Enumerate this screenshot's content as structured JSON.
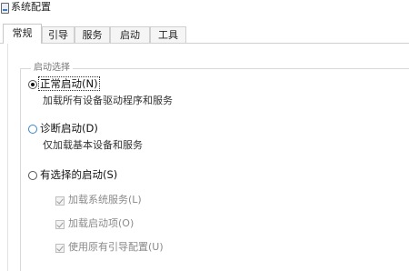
{
  "window": {
    "title": "系统配置",
    "icon": "msconfig-icon"
  },
  "tabs": [
    {
      "label": "常规",
      "active": true
    },
    {
      "label": "引导",
      "active": false
    },
    {
      "label": "服务",
      "active": false
    },
    {
      "label": "启动",
      "active": false
    },
    {
      "label": "工具",
      "active": false
    }
  ],
  "startup_group": {
    "label": "启动选择",
    "options": [
      {
        "label": "正常启动(N)",
        "description": "加载所有设备驱动程序和服务",
        "selected": true
      },
      {
        "label": "诊断启动(D)",
        "description": "仅加载基本设备和服务",
        "selected": false
      },
      {
        "label": "有选择的启动(S)",
        "selected": false
      }
    ],
    "checkboxes": [
      {
        "label": "加载系统服务(L)",
        "checked": true,
        "enabled": false
      },
      {
        "label": "加载启动项(O)",
        "checked": true,
        "enabled": false
      },
      {
        "label": "使用原有引导配置(U)",
        "checked": true,
        "enabled": false
      }
    ]
  }
}
